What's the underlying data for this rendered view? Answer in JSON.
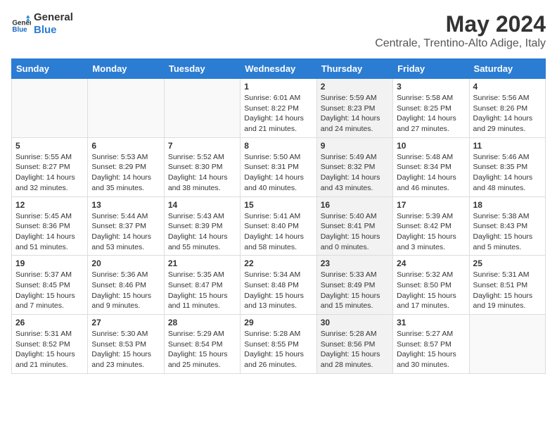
{
  "header": {
    "logo_line1": "General",
    "logo_line2": "Blue",
    "month": "May 2024",
    "location": "Centrale, Trentino-Alto Adige, Italy"
  },
  "weekdays": [
    "Sunday",
    "Monday",
    "Tuesday",
    "Wednesday",
    "Thursday",
    "Friday",
    "Saturday"
  ],
  "weeks": [
    [
      {
        "day": "",
        "info": "",
        "shaded": false
      },
      {
        "day": "",
        "info": "",
        "shaded": false
      },
      {
        "day": "",
        "info": "",
        "shaded": false
      },
      {
        "day": "1",
        "info": "Sunrise: 6:01 AM\nSunset: 8:22 PM\nDaylight: 14 hours\nand 21 minutes.",
        "shaded": false
      },
      {
        "day": "2",
        "info": "Sunrise: 5:59 AM\nSunset: 8:23 PM\nDaylight: 14 hours\nand 24 minutes.",
        "shaded": true
      },
      {
        "day": "3",
        "info": "Sunrise: 5:58 AM\nSunset: 8:25 PM\nDaylight: 14 hours\nand 27 minutes.",
        "shaded": false
      },
      {
        "day": "4",
        "info": "Sunrise: 5:56 AM\nSunset: 8:26 PM\nDaylight: 14 hours\nand 29 minutes.",
        "shaded": false
      }
    ],
    [
      {
        "day": "5",
        "info": "Sunrise: 5:55 AM\nSunset: 8:27 PM\nDaylight: 14 hours\nand 32 minutes.",
        "shaded": false
      },
      {
        "day": "6",
        "info": "Sunrise: 5:53 AM\nSunset: 8:29 PM\nDaylight: 14 hours\nand 35 minutes.",
        "shaded": false
      },
      {
        "day": "7",
        "info": "Sunrise: 5:52 AM\nSunset: 8:30 PM\nDaylight: 14 hours\nand 38 minutes.",
        "shaded": false
      },
      {
        "day": "8",
        "info": "Sunrise: 5:50 AM\nSunset: 8:31 PM\nDaylight: 14 hours\nand 40 minutes.",
        "shaded": false
      },
      {
        "day": "9",
        "info": "Sunrise: 5:49 AM\nSunset: 8:32 PM\nDaylight: 14 hours\nand 43 minutes.",
        "shaded": true
      },
      {
        "day": "10",
        "info": "Sunrise: 5:48 AM\nSunset: 8:34 PM\nDaylight: 14 hours\nand 46 minutes.",
        "shaded": false
      },
      {
        "day": "11",
        "info": "Sunrise: 5:46 AM\nSunset: 8:35 PM\nDaylight: 14 hours\nand 48 minutes.",
        "shaded": false
      }
    ],
    [
      {
        "day": "12",
        "info": "Sunrise: 5:45 AM\nSunset: 8:36 PM\nDaylight: 14 hours\nand 51 minutes.",
        "shaded": false
      },
      {
        "day": "13",
        "info": "Sunrise: 5:44 AM\nSunset: 8:37 PM\nDaylight: 14 hours\nand 53 minutes.",
        "shaded": false
      },
      {
        "day": "14",
        "info": "Sunrise: 5:43 AM\nSunset: 8:39 PM\nDaylight: 14 hours\nand 55 minutes.",
        "shaded": false
      },
      {
        "day": "15",
        "info": "Sunrise: 5:41 AM\nSunset: 8:40 PM\nDaylight: 14 hours\nand 58 minutes.",
        "shaded": false
      },
      {
        "day": "16",
        "info": "Sunrise: 5:40 AM\nSunset: 8:41 PM\nDaylight: 15 hours\nand 0 minutes.",
        "shaded": true
      },
      {
        "day": "17",
        "info": "Sunrise: 5:39 AM\nSunset: 8:42 PM\nDaylight: 15 hours\nand 3 minutes.",
        "shaded": false
      },
      {
        "day": "18",
        "info": "Sunrise: 5:38 AM\nSunset: 8:43 PM\nDaylight: 15 hours\nand 5 minutes.",
        "shaded": false
      }
    ],
    [
      {
        "day": "19",
        "info": "Sunrise: 5:37 AM\nSunset: 8:45 PM\nDaylight: 15 hours\nand 7 minutes.",
        "shaded": false
      },
      {
        "day": "20",
        "info": "Sunrise: 5:36 AM\nSunset: 8:46 PM\nDaylight: 15 hours\nand 9 minutes.",
        "shaded": false
      },
      {
        "day": "21",
        "info": "Sunrise: 5:35 AM\nSunset: 8:47 PM\nDaylight: 15 hours\nand 11 minutes.",
        "shaded": false
      },
      {
        "day": "22",
        "info": "Sunrise: 5:34 AM\nSunset: 8:48 PM\nDaylight: 15 hours\nand 13 minutes.",
        "shaded": false
      },
      {
        "day": "23",
        "info": "Sunrise: 5:33 AM\nSunset: 8:49 PM\nDaylight: 15 hours\nand 15 minutes.",
        "shaded": true
      },
      {
        "day": "24",
        "info": "Sunrise: 5:32 AM\nSunset: 8:50 PM\nDaylight: 15 hours\nand 17 minutes.",
        "shaded": false
      },
      {
        "day": "25",
        "info": "Sunrise: 5:31 AM\nSunset: 8:51 PM\nDaylight: 15 hours\nand 19 minutes.",
        "shaded": false
      }
    ],
    [
      {
        "day": "26",
        "info": "Sunrise: 5:31 AM\nSunset: 8:52 PM\nDaylight: 15 hours\nand 21 minutes.",
        "shaded": false
      },
      {
        "day": "27",
        "info": "Sunrise: 5:30 AM\nSunset: 8:53 PM\nDaylight: 15 hours\nand 23 minutes.",
        "shaded": false
      },
      {
        "day": "28",
        "info": "Sunrise: 5:29 AM\nSunset: 8:54 PM\nDaylight: 15 hours\nand 25 minutes.",
        "shaded": false
      },
      {
        "day": "29",
        "info": "Sunrise: 5:28 AM\nSunset: 8:55 PM\nDaylight: 15 hours\nand 26 minutes.",
        "shaded": false
      },
      {
        "day": "30",
        "info": "Sunrise: 5:28 AM\nSunset: 8:56 PM\nDaylight: 15 hours\nand 28 minutes.",
        "shaded": true
      },
      {
        "day": "31",
        "info": "Sunrise: 5:27 AM\nSunset: 8:57 PM\nDaylight: 15 hours\nand 30 minutes.",
        "shaded": false
      },
      {
        "day": "",
        "info": "",
        "shaded": false
      }
    ]
  ]
}
